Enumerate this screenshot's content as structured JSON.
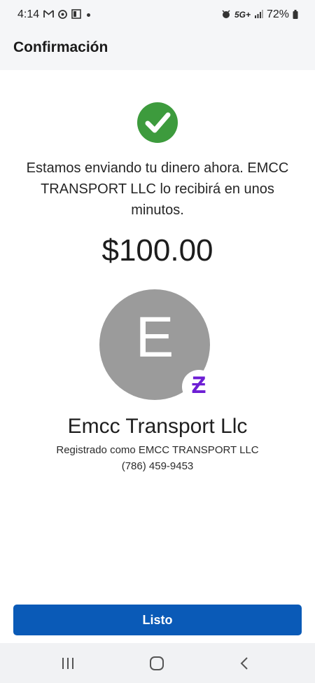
{
  "status_bar": {
    "time": "4:14",
    "network": "5G+",
    "battery": "72%",
    "left_icons": [
      "gmail-icon",
      "chrome-icon",
      "app-icon",
      "notification-dot"
    ],
    "right_icons": [
      "alarm-icon",
      "signal-icon",
      "battery-icon"
    ]
  },
  "header": {
    "title": "Confirmación"
  },
  "confirmation": {
    "icon": "check-circle-icon",
    "message": "Estamos enviando tu dinero ahora. EMCC TRANSPORT LLC lo recibirá en unos minutos.",
    "amount": "$100.00"
  },
  "recipient": {
    "avatar_initial": "E",
    "avatar_color": "#9b9b9b",
    "badge_glyph": "Ƶ",
    "badge_icon": "zelle-icon",
    "name": "Emcc Transport Llc",
    "registered_as": "Registrado como EMCC TRANSPORT LLC",
    "phone": "(786) 459-9453"
  },
  "actions": {
    "done_label": "Listo"
  },
  "colors": {
    "primary": "#0a5ab7",
    "success": "#3d9b3d",
    "zelle_purple": "#6d1ed4",
    "header_bg": "#f5f6f8"
  },
  "nav_bar": {
    "buttons": [
      "recent-apps-icon",
      "home-icon",
      "back-icon"
    ]
  }
}
